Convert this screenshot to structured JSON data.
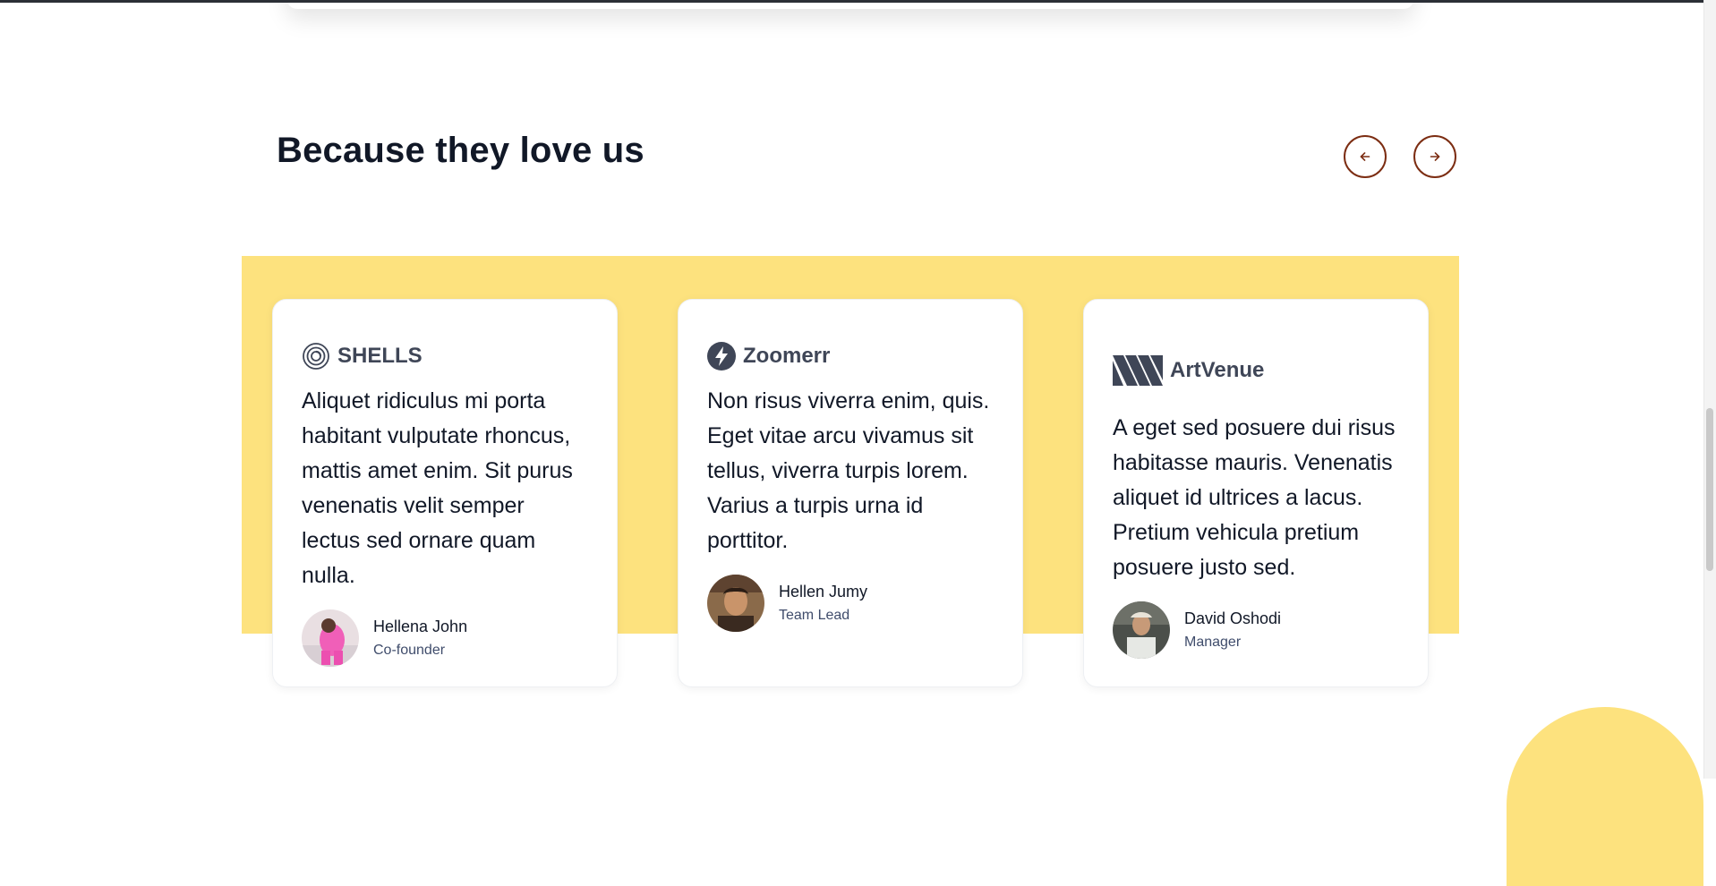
{
  "section": {
    "title": "Because they love us",
    "prev_icon": "arrow-left-icon",
    "next_icon": "arrow-right-icon"
  },
  "colors": {
    "band": "#fde27e",
    "accent": "#7c2d12",
    "brand_text": "#3f4657",
    "role_text": "#3f4c6b"
  },
  "testimonials": [
    {
      "brand": "SHELLS",
      "brand_icon": "spiral-logo-icon",
      "quote": "Aliquet ridiculus mi porta habitant vulputate rhoncus, mattis amet enim. Sit purus venenatis velit semper lectus sed ornare quam nulla.",
      "name": "Hellena John",
      "role": "Co-founder"
    },
    {
      "brand": "Zoomerr",
      "brand_icon": "lightning-logo-icon",
      "quote": "Non risus viverra enim, quis. Eget vitae arcu vivamus sit tellus, viverra turpis lorem. Varius a turpis urna id porttitor.",
      "name": "Hellen Jumy",
      "role": "Team Lead"
    },
    {
      "brand": "ArtVenue",
      "brand_icon": "stripes-logo-icon",
      "quote": "A eget sed posuere dui risus habitasse mauris. Venenatis aliquet id ultrices a lacus. Pretium vehicula pretium posuere justo sed.",
      "name": "David Oshodi",
      "role": "Manager"
    }
  ]
}
